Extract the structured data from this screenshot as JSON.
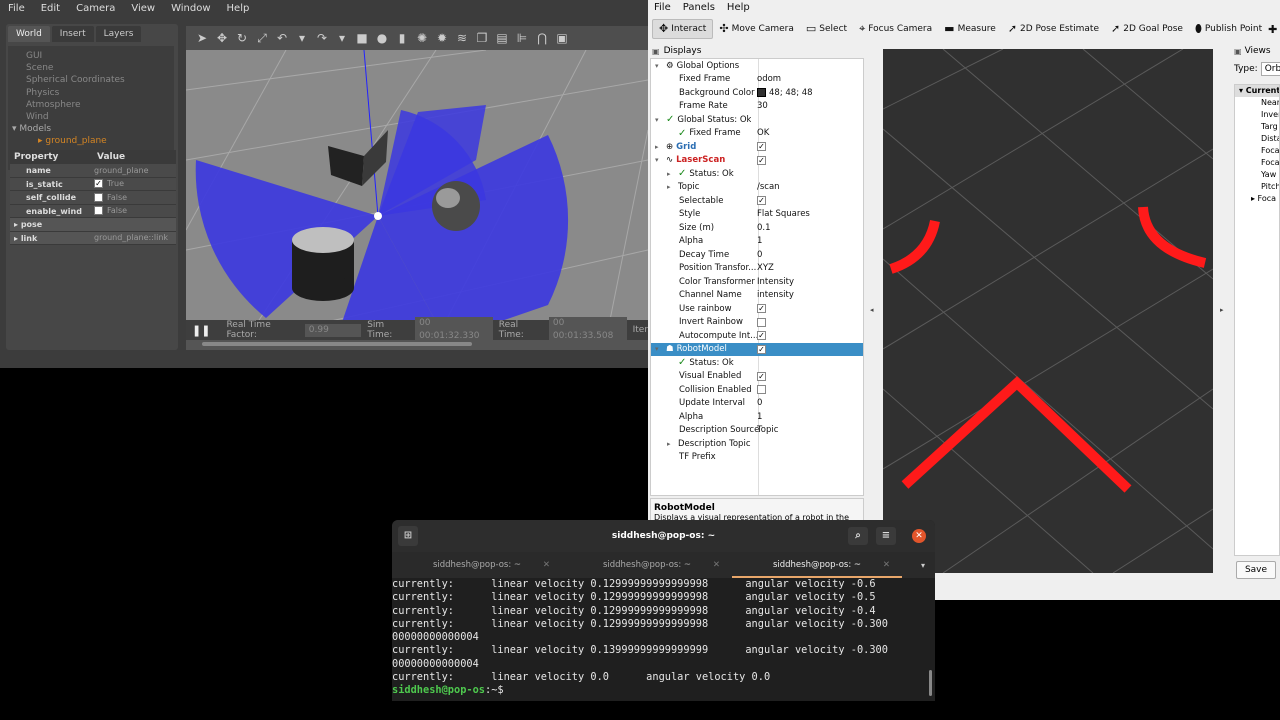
{
  "gazebo": {
    "menu": [
      "File",
      "Edit",
      "Camera",
      "View",
      "Window",
      "Help"
    ],
    "tabs": [
      "World",
      "Insert",
      "Layers"
    ],
    "tree": [
      "GUI",
      "Scene",
      "Spherical Coordinates",
      "Physics",
      "Atmosphere",
      "Wind"
    ],
    "models_label": "Models",
    "model_item": "ground_plane",
    "props_header": {
      "property": "Property",
      "value": "Value"
    },
    "props": [
      {
        "key": "name",
        "value": "ground_plane"
      },
      {
        "key": "is_static",
        "value": "True",
        "checked": true
      },
      {
        "key": "self_collide",
        "value": "False",
        "checked": false
      },
      {
        "key": "enable_wind",
        "value": "False",
        "checked": false
      }
    ],
    "sections": [
      {
        "key": "pose",
        "value": ""
      },
      {
        "key": "link",
        "value": "ground_plane::link"
      }
    ],
    "status": {
      "rtf_label": "Real Time Factor:",
      "rtf": "0.99",
      "sim_label": "Sim Time:",
      "sim": "00 00:01:32.330",
      "real_label": "Real Time:",
      "real": "00 00:01:33.508",
      "iter_label": "Iter"
    }
  },
  "rviz": {
    "menu": [
      "File",
      "Panels",
      "Help"
    ],
    "tools": [
      {
        "label": "Interact",
        "icon": "interact-icon",
        "glyph": "✥",
        "active": true
      },
      {
        "label": "Move Camera",
        "icon": "move-camera-icon",
        "glyph": "✣"
      },
      {
        "label": "Select",
        "icon": "select-icon",
        "glyph": "▭"
      },
      {
        "label": "Focus Camera",
        "icon": "focus-camera-icon",
        "glyph": "⌖"
      },
      {
        "label": "Measure",
        "icon": "measure-icon",
        "glyph": "▬"
      },
      {
        "label": "2D Pose Estimate",
        "icon": "pose-estimate-icon",
        "glyph": "➚"
      },
      {
        "label": "2D Goal Pose",
        "icon": "goal-pose-icon",
        "glyph": "➚"
      },
      {
        "label": "Publish Point",
        "icon": "publish-point-icon",
        "glyph": "⬮"
      }
    ],
    "displays_title": "Displays",
    "displays": [
      {
        "k": "Global Options",
        "lvl": 0,
        "arrow": "▾",
        "icon": "⚙",
        "ic": "blue-ic"
      },
      {
        "k": "Fixed Frame",
        "lvl": 1,
        "v": "odom"
      },
      {
        "k": "Background Color",
        "lvl": 1,
        "v": "48; 48; 48",
        "swatch": "#303030"
      },
      {
        "k": "Frame Rate",
        "lvl": 1,
        "v": "30"
      },
      {
        "k": "Global Status: Ok",
        "lvl": 0,
        "arrow": "▾",
        "check": true
      },
      {
        "k": "Fixed Frame",
        "lvl": 1,
        "v": "OK",
        "check": true
      },
      {
        "k": "Grid",
        "lvl": 0,
        "arrow": "▸",
        "icon": "⊕",
        "cls": "blue",
        "cb": true
      },
      {
        "k": "LaserScan",
        "lvl": 0,
        "arrow": "▾",
        "icon": "∿",
        "cls": "red",
        "cb": true
      },
      {
        "k": "Status: Ok",
        "lvl": 1,
        "arrow": "▸",
        "check": true
      },
      {
        "k": "Topic",
        "lvl": 1,
        "arrow": "▸",
        "v": "/scan"
      },
      {
        "k": "Selectable",
        "lvl": 1,
        "cb": true
      },
      {
        "k": "Style",
        "lvl": 1,
        "v": "Flat Squares"
      },
      {
        "k": "Size (m)",
        "lvl": 1,
        "v": "0.1"
      },
      {
        "k": "Alpha",
        "lvl": 1,
        "v": "1"
      },
      {
        "k": "Decay Time",
        "lvl": 1,
        "v": "0"
      },
      {
        "k": "Position Transfor...",
        "lvl": 1,
        "v": "XYZ"
      },
      {
        "k": "Color Transformer",
        "lvl": 1,
        "v": "Intensity"
      },
      {
        "k": "Channel Name",
        "lvl": 1,
        "v": "intensity"
      },
      {
        "k": "Use rainbow",
        "lvl": 1,
        "cb": true
      },
      {
        "k": "Invert Rainbow",
        "lvl": 1,
        "cb": false
      },
      {
        "k": "Autocompute Int...",
        "lvl": 1,
        "cb": true
      },
      {
        "k": "RobotModel",
        "lvl": 0,
        "arrow": "▾",
        "icon": "☗",
        "sel": true,
        "cb": true
      },
      {
        "k": "Status: Ok",
        "lvl": 1,
        "check": true
      },
      {
        "k": "Visual Enabled",
        "lvl": 1,
        "cb": true
      },
      {
        "k": "Collision Enabled",
        "lvl": 1,
        "cb": false
      },
      {
        "k": "Update Interval",
        "lvl": 1,
        "v": "0"
      },
      {
        "k": "Alpha",
        "lvl": 1,
        "v": "1"
      },
      {
        "k": "Description Source",
        "lvl": 1,
        "v": "Topic"
      },
      {
        "k": "Description Topic",
        "lvl": 1,
        "arrow": "▸"
      },
      {
        "k": "TF Prefix",
        "lvl": 1
      }
    ],
    "description": {
      "title": "RobotModel",
      "text": "Displays a visual representation of a robot in the"
    },
    "views": {
      "title": "Views",
      "type_label": "Type:",
      "type_value": "Orbit",
      "tree": [
        "Current",
        "Near",
        "Inver",
        "Targ",
        "Dista",
        "Foca",
        "Foca",
        "Yaw",
        "Pitch",
        "Foca"
      ],
      "save": "Save"
    }
  },
  "terminal": {
    "title": "siddhesh@pop-os: ~",
    "tabs": [
      "siddhesh@pop-os: ~",
      "siddhesh@pop-os: ~",
      "siddhesh@pop-os: ~"
    ],
    "lines": [
      "currently:      linear velocity 0.12999999999999998      angular velocity -0.6",
      "currently:      linear velocity 0.12999999999999998      angular velocity -0.5",
      "currently:      linear velocity 0.12999999999999998      angular velocity -0.4",
      "currently:      linear velocity 0.12999999999999998      angular velocity -0.300",
      "00000000000004",
      "currently:      linear velocity 0.13999999999999999      angular velocity -0.300",
      "00000000000004",
      "currently:      linear velocity 0.0      angular velocity 0.0"
    ],
    "prompt": "siddhesh@pop-os",
    "prompt_suffix": ":~$"
  }
}
